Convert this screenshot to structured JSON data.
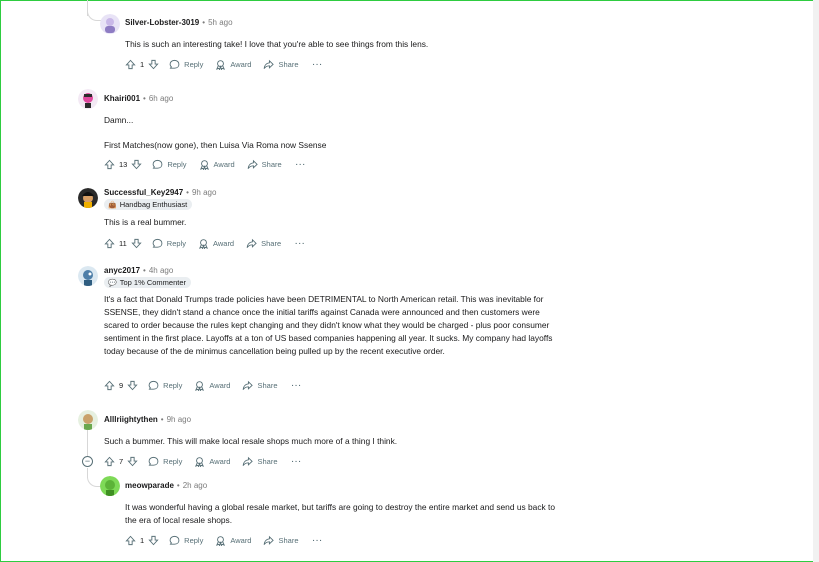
{
  "comments": [
    {
      "id": "c0",
      "user": "Silver-Lobster-3019",
      "time": "5h ago",
      "body": [
        "This is such an interesting take! I love that you're able to see things from this lens."
      ],
      "score": "1",
      "reply": "Reply",
      "award": "Award",
      "share": "Share",
      "more": "···"
    },
    {
      "id": "c1",
      "user": "Khairi001",
      "time": "6h ago",
      "body": [
        "Damn...",
        "First Matches(now gone), then Luisa Via Roma now Ssense"
      ],
      "score": "13",
      "reply": "Reply",
      "award": "Award",
      "share": "Share",
      "more": "···"
    },
    {
      "id": "c2",
      "user": "Successful_Key2947",
      "time": "9h ago",
      "flair": "Handbag Enthusiast",
      "body": [
        "This is a real bummer."
      ],
      "score": "11",
      "reply": "Reply",
      "award": "Award",
      "share": "Share",
      "more": "···"
    },
    {
      "id": "c3",
      "user": "anyc2017",
      "time": "4h ago",
      "flair": "Top 1% Commenter",
      "body": [
        "It's a fact that Donald Trumps trade policies have been DETRIMENTAL to North American retail. This was inevitable for SSENSE, they didn't stand a chance once the initial tariffs against Canada were announced and then customers were scared to order because the rules kept changing and they didn't know what they would be charged - plus poor consumer sentiment in the first place. Layoffs at a ton of US based companies happening all year. It sucks. My company had layoffs today because of the de minimus cancellation being pulled up by the recent executive order."
      ],
      "score": "9",
      "reply": "Reply",
      "award": "Award",
      "share": "Share",
      "more": "···"
    },
    {
      "id": "c4",
      "user": "Alllriightythen",
      "time": "9h ago",
      "body": [
        "Such a bummer. This will make local resale shops much more of a thing I think."
      ],
      "score": "7",
      "reply": "Reply",
      "award": "Award",
      "share": "Share",
      "more": "···"
    },
    {
      "id": "c5",
      "user": "meowparade",
      "time": "2h ago",
      "body": [
        "It was wonderful having a global resale market, but tariffs are going to destroy the entire market and send us back to the era of local resale shops."
      ],
      "score": "1",
      "reply": "Reply",
      "award": "Award",
      "share": "Share",
      "more": "···"
    }
  ],
  "collapse_symbol": "−",
  "colors": {
    "frame": "#2ecc40",
    "meta": "#7c7c7c",
    "action": "#576f76",
    "flair_bg": "#eaeef1"
  }
}
